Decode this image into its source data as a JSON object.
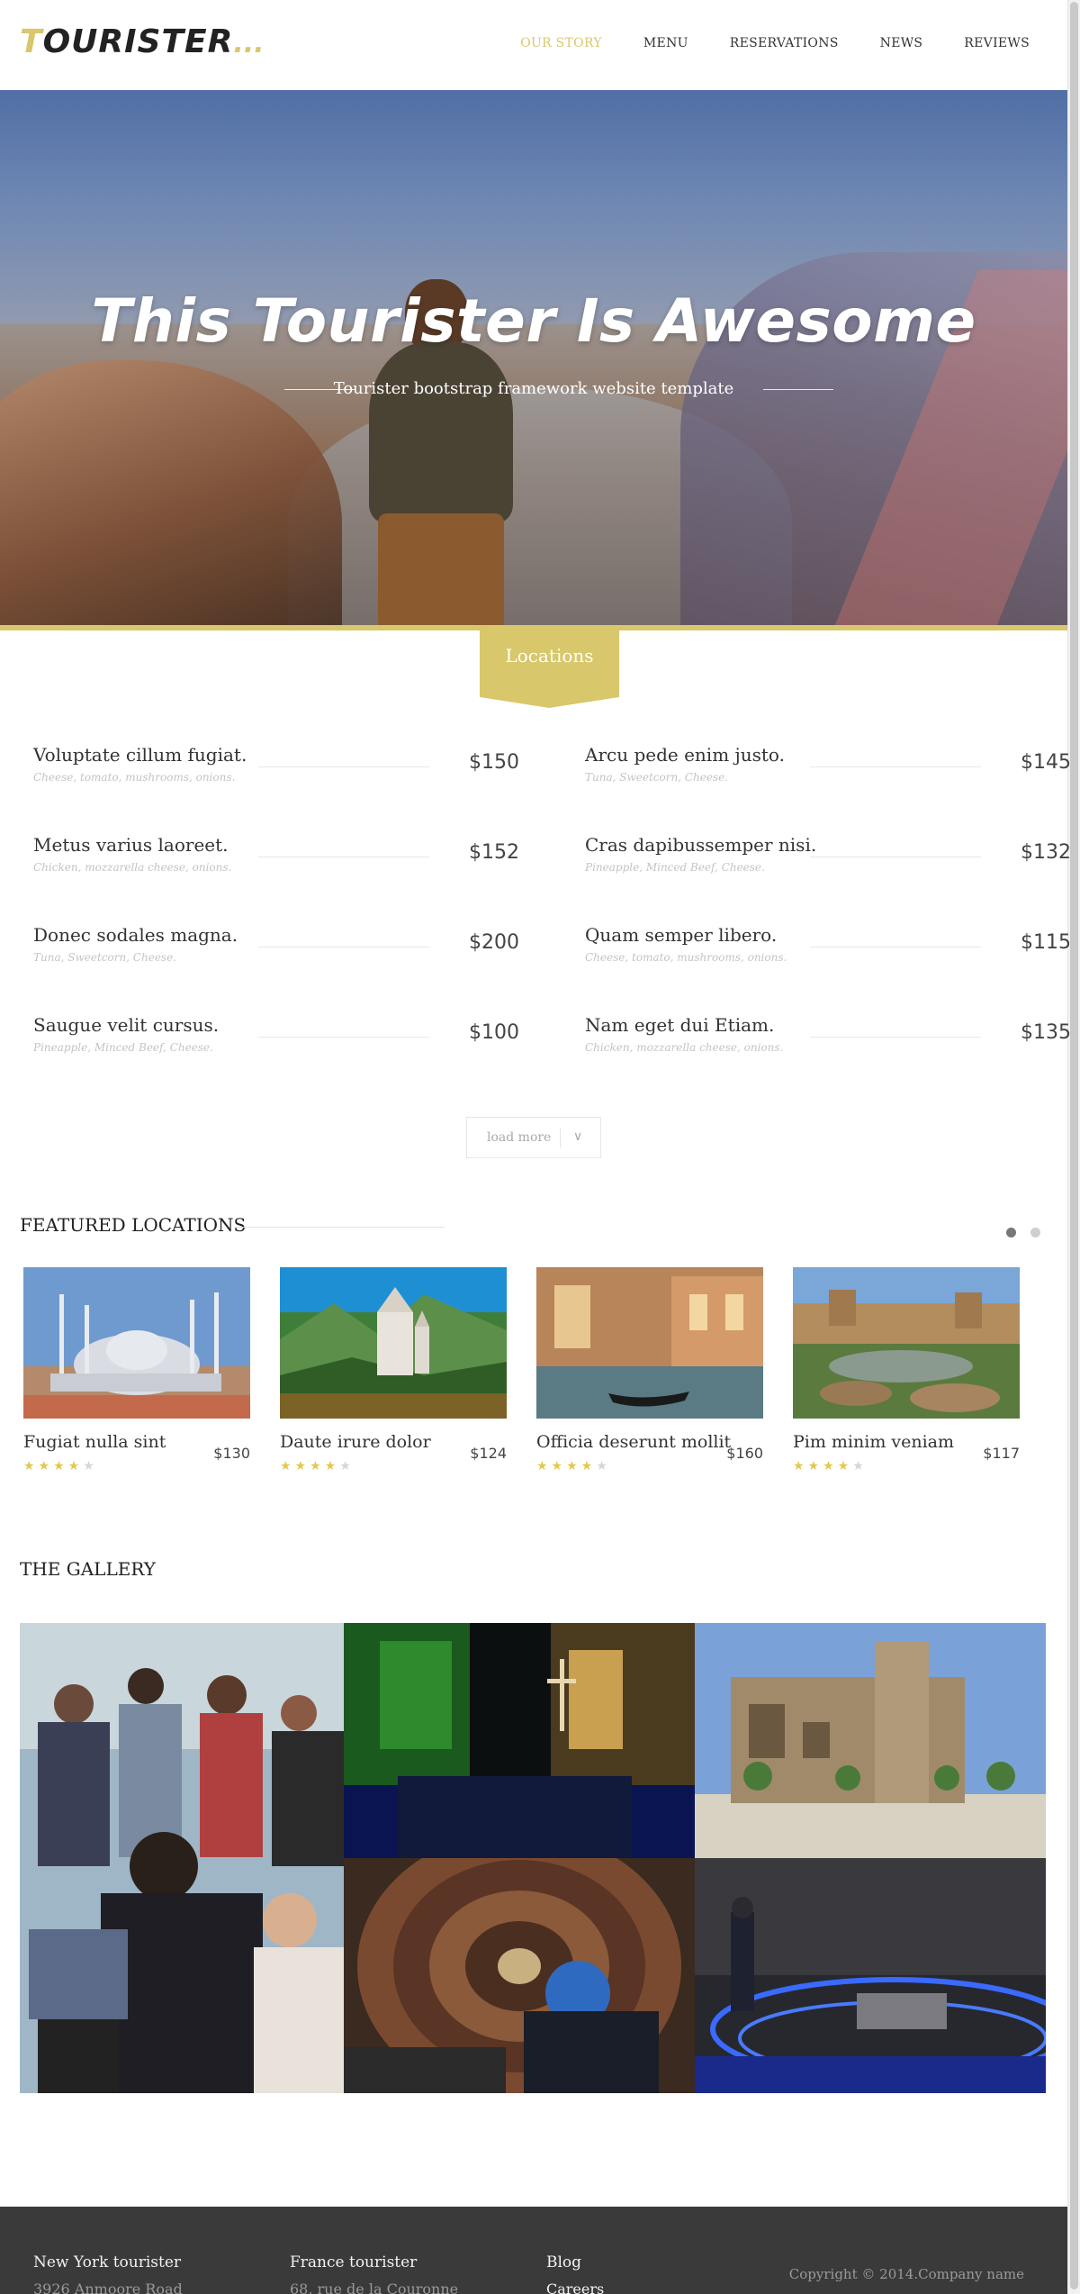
{
  "brand": {
    "first_letter": "T",
    "rest": "OURISTER",
    "dots": "..."
  },
  "nav": {
    "items": [
      {
        "label": "OUR STORY"
      },
      {
        "label": "MENU"
      },
      {
        "label": "RESERVATIONS"
      },
      {
        "label": "NEWS"
      },
      {
        "label": "REVIEWS"
      }
    ],
    "active_color": "#d8c76b"
  },
  "hero": {
    "title": "This Tourister Is Awesome",
    "subtitle": "Tourister bootstrap framework website template"
  },
  "locations": {
    "tab_label": "Locations",
    "items": [
      {
        "name": "Voluptate cillum fugiat.",
        "desc": "Cheese, tomato, mushrooms, onions.",
        "price": "$150"
      },
      {
        "name": "Arcu pede enim justo.",
        "desc": "Tuna, Sweetcorn, Cheese.",
        "price": "$145"
      },
      {
        "name": "Metus varius laoreet.",
        "desc": "Chicken, mozzarella cheese, onions.",
        "price": "$152"
      },
      {
        "name": "Cras dapibussemper nisi.",
        "desc": "Pineapple, Minced Beef, Cheese.",
        "price": "$132"
      },
      {
        "name": "Donec sodales magna.",
        "desc": "Tuna, Sweetcorn, Cheese.",
        "price": "$200"
      },
      {
        "name": "Quam semper libero.",
        "desc": "Cheese, tomato, mushrooms, onions.",
        "price": "$115"
      },
      {
        "name": "Saugue velit cursus.",
        "desc": "Pineapple, Minced Beef, Cheese.",
        "price": "$100"
      },
      {
        "name": "Nam eget dui Etiam.",
        "desc": "Chicken, mozzarella cheese, onions.",
        "price": "$135"
      }
    ],
    "load_more_label": "load more",
    "chevron_icon": "chevron-down-icon"
  },
  "featured": {
    "title": "FEATURED LOCATIONS",
    "cards": [
      {
        "name": "Fugiat nulla sint",
        "price": "$130",
        "rating": 4,
        "max": 5
      },
      {
        "name": "Daute irure dolor",
        "price": "$124",
        "rating": 4,
        "max": 5
      },
      {
        "name": "Officia deserunt mollit",
        "price": "$160",
        "rating": 4,
        "max": 5
      },
      {
        "name": "Pim minim veniam",
        "price": "$117",
        "rating": 4,
        "max": 5
      }
    ],
    "star_on_color": "#e4c84a",
    "star_off_color": "#d6d6d6"
  },
  "gallery": {
    "title": "THE GALLERY"
  },
  "footer": {
    "col1_title": "New York tourister",
    "col1_line": "3926 Anmoore Road",
    "col2_title": "France tourister",
    "col2_line": "68, rue de la Couronne",
    "col3_title": "Blog",
    "col3_line": "Careers",
    "copyright": "Copyright © 2014.Company name"
  },
  "colors": {
    "accent": "#d8c76b",
    "footer_bg": "#3a3a3a"
  }
}
